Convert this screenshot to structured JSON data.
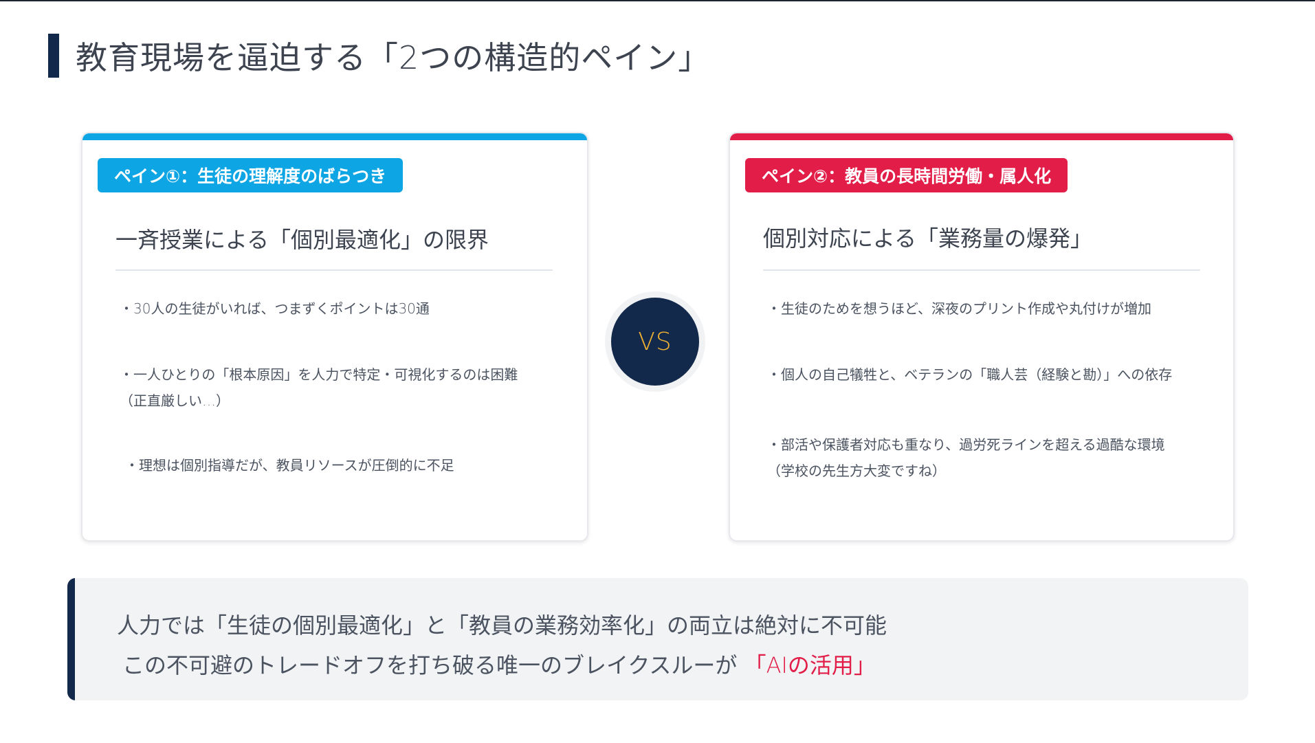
{
  "title": "教育現場を逼迫する「2つの構造的ペイン」",
  "left_card": {
    "badge": "ペイン①：生徒の理解度のばらつき",
    "heading": "一斉授業による「個別最適化」の限界",
    "items": [
      "・30人の生徒がいれば、つまずくポイントは30通",
      "・一人ひとりの「根本原因」を人力で特定・可視化するのは困難",
      "（正直厳しい…）",
      "・理想は個別指導だが、教員リソースが圧倒的に不足"
    ]
  },
  "vs_label": "VS",
  "right_card": {
    "badge": "ペイン②：教員の長時間労働・属人化",
    "heading": "個別対応による「業務量の爆発」",
    "items": [
      "・生徒のためを想うほど、深夜のプリント作成や丸付けが増加",
      "・個人の自己犠牲と、ベテランの「職人芸（経験と勘）」への依存",
      "・部活や保護者対応も重なり、過労死ラインを超える過酷な環境",
      "（学校の先生方大変ですね）"
    ]
  },
  "bottom": {
    "line1": "人力では「生徒の個別最適化」と「教員の業務効率化」の両立は絶対に不可能",
    "line2_prefix": "この不可避のトレードオフを打ち破る唯一のブレイクスルーが",
    "line2_highlight": "「AIの活用」"
  },
  "colors": {
    "navy": "#13294b",
    "blue": "#0ea5e5",
    "red": "#e11d48",
    "gold": "#f0b232"
  }
}
